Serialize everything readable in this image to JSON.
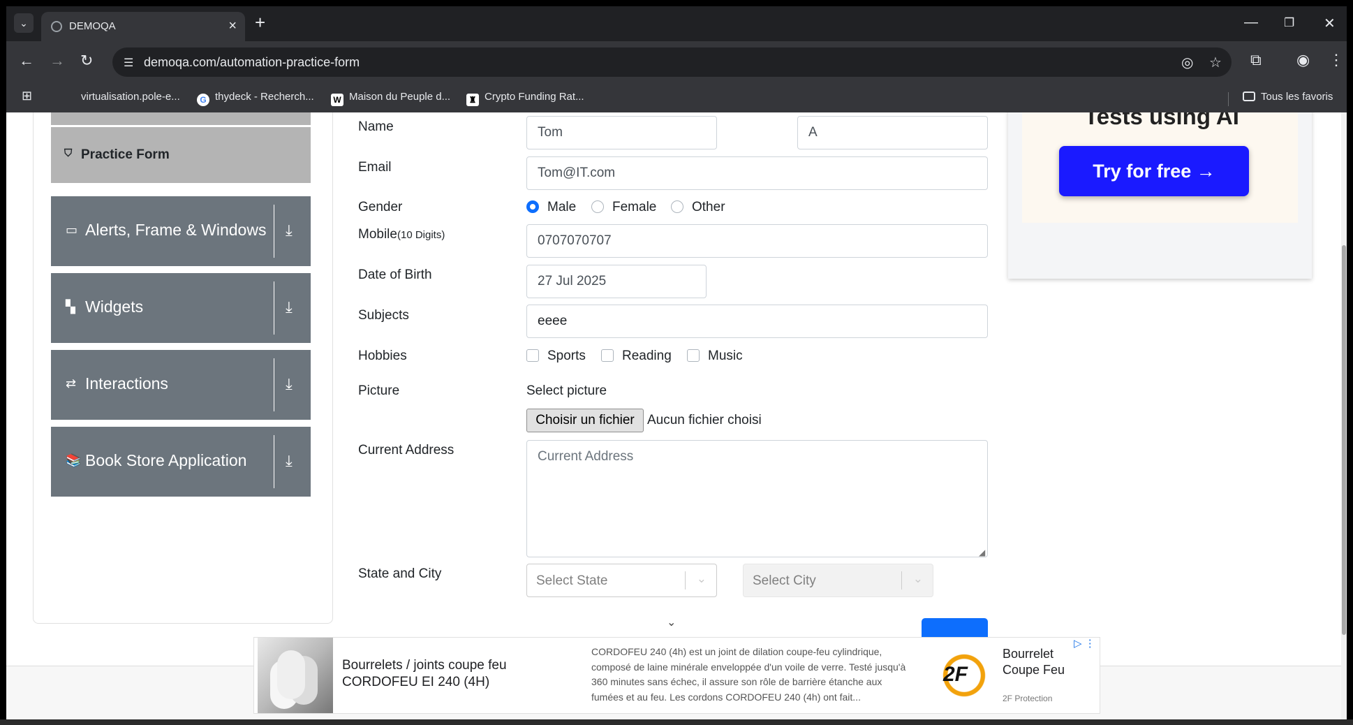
{
  "browser": {
    "tab_title": "DEMOQA",
    "new_tab": "+",
    "tab_close": "×",
    "url": "demoqa.com/automation-practice-form",
    "bookmarks": [
      {
        "label": "virtualisation.pole-e..."
      },
      {
        "label": "thydeck - Recherch..."
      },
      {
        "label": "Maison du Peuple d..."
      },
      {
        "label": "Crypto Funding Rat..."
      }
    ],
    "all_bookmarks": "Tous les favoris"
  },
  "sidebar": {
    "active_item": "Practice Form",
    "groups": [
      {
        "label": "Alerts, Frame & Windows",
        "icon": "window-icon"
      },
      {
        "label": "Widgets",
        "icon": "widgets-icon"
      },
      {
        "label": "Interactions",
        "icon": "interactions-icon"
      },
      {
        "label": "Book Store Application",
        "icon": "books-icon"
      }
    ]
  },
  "form": {
    "name_label": "Name",
    "first_name": "Tom",
    "last_name": "A",
    "email_label": "Email",
    "email": "Tom@IT.com",
    "gender_label": "Gender",
    "gender_options": [
      "Male",
      "Female",
      "Other"
    ],
    "gender_selected": "Male",
    "mobile_label": "Mobile",
    "mobile_hint": "(10 Digits)",
    "mobile": "0707070707",
    "dob_label": "Date of Birth",
    "dob": "27 Jul 2025",
    "subjects_label": "Subjects",
    "subjects": "eeee",
    "hobbies_label": "Hobbies",
    "hobbies": [
      "Sports",
      "Reading",
      "Music"
    ],
    "picture_label": "Picture",
    "select_picture": "Select picture",
    "file_button": "Choisir un fichier",
    "file_status": "Aucun fichier choisi",
    "address_label": "Current Address",
    "address_placeholder": "Current Address",
    "state_city_label": "State and City",
    "state_placeholder": "Select State",
    "city_placeholder": "Select City"
  },
  "ad_right": {
    "heading": "Tests using AI",
    "button": "Try for free →"
  },
  "ad_bottom": {
    "title": "Bourrelets / joints coupe feu CORDOFEU EI 240 (4H)",
    "description": "CORDOFEU 240 (4h) est un joint de dilation coupe-feu cylindrique, composé de laine minérale enveloppée d'un voile de verre. Testé jusqu'à 360 minutes sans échec, il assure son rôle de barrière étanche aux fumées et au feu. Les cordons CORDOFEU 240 (4h) ont fait...",
    "logo_text": "2F",
    "brand": "Bourrelet Coupe Feu",
    "source": "2F Protection"
  }
}
